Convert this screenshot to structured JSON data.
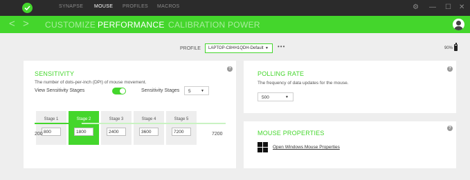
{
  "app": {
    "top_tabs": [
      "SYNAPSE",
      "MOUSE",
      "PROFILES",
      "MACROS"
    ],
    "active_top_tab": "MOUSE",
    "window_controls": {
      "settings": "⚙",
      "minimize": "—",
      "maximize": "☐",
      "close": "✕"
    }
  },
  "nav": {
    "back": "<",
    "forward": ">",
    "tabs": [
      "CUSTOMIZE",
      "PERFORMANCE",
      "CALIBRATION",
      "POWER"
    ],
    "active_tab": "PERFORMANCE"
  },
  "profile": {
    "label": "PROFILE",
    "selected": "LAPTOP-C8HH1QDH-Default",
    "more": "•••"
  },
  "battery": {
    "text": "90%",
    "level": 0.9
  },
  "sensitivity": {
    "title": "SENSITIVITY",
    "description": "The number of dots-per-inch (DPI) of mouse movement.",
    "view_stages_label": "View Sensitivity Stages",
    "view_stages_on": true,
    "stages_count_label": "Sensitivity Stages",
    "stages_count": "5",
    "stages": [
      {
        "label": "Stage 1",
        "value": "800"
      },
      {
        "label": "Stage 2",
        "value": "1800"
      },
      {
        "label": "Stage 3",
        "value": "2400"
      },
      {
        "label": "Stage 4",
        "value": "3600"
      },
      {
        "label": "Stage 5",
        "value": "7200"
      }
    ],
    "active_stage": 1,
    "slider": {
      "min": 200,
      "max": 7200,
      "value": 1800,
      "min_label": "200",
      "max_label": "7200"
    }
  },
  "polling": {
    "title": "POLLING RATE",
    "description": "The frequency of data updates for the mouse.",
    "selected": "500"
  },
  "mouse_properties": {
    "title": "MOUSE PROPERTIES",
    "link": "Open Windows Mouse Properties"
  },
  "help_glyph": "?",
  "caret_glyph": "▼",
  "colors": {
    "accent": "#44d62c",
    "titlebar": "#2b2b2b",
    "background": "#eeeeee"
  }
}
